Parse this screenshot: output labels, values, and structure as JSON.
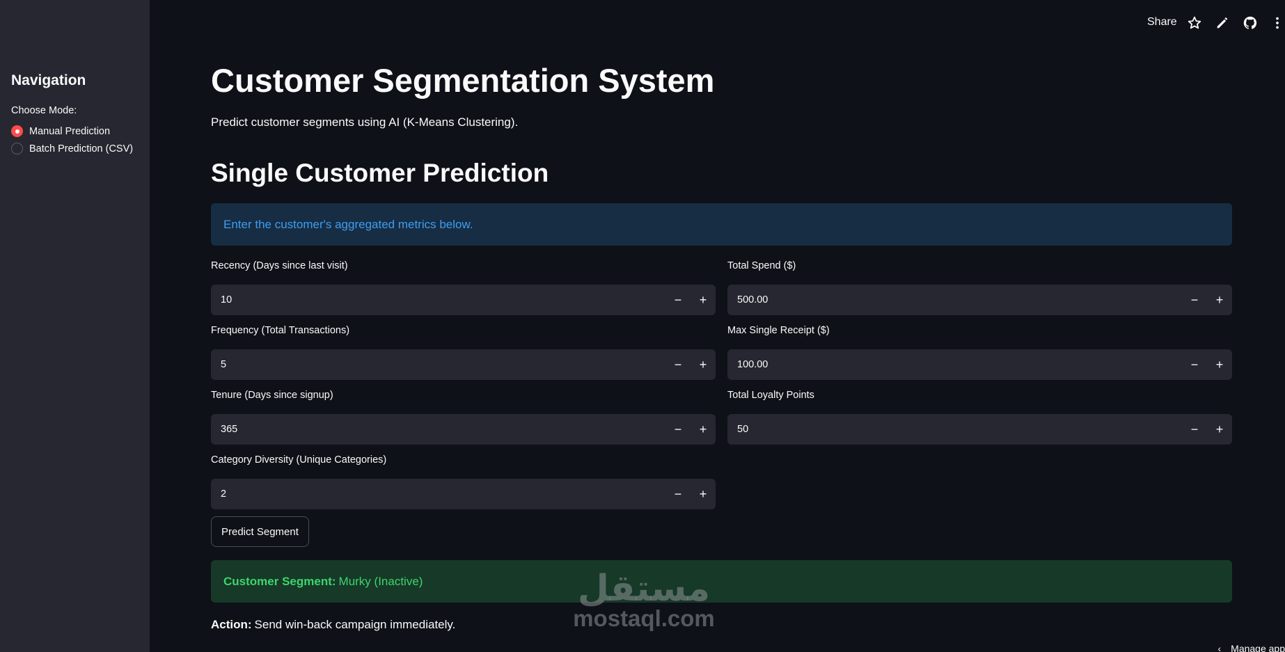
{
  "sidebar": {
    "title": "Navigation",
    "mode_label": "Choose Mode:",
    "options": [
      {
        "label": "Manual Prediction",
        "selected": true
      },
      {
        "label": "Batch Prediction (CSV)",
        "selected": false
      }
    ]
  },
  "toolbar": {
    "share_label": "Share",
    "icons": [
      "star-icon",
      "pencil-icon",
      "github-icon",
      "more-vertical-icon"
    ]
  },
  "main": {
    "title": "Customer Segmentation System",
    "subtitle": "Predict customer segments using AI (K-Means Clustering).",
    "section_title": "Single Customer Prediction",
    "info_text": "Enter the customer's aggregated metrics below.",
    "fields": {
      "recency": {
        "label": "Recency (Days since last visit)",
        "value": "10"
      },
      "total_spend": {
        "label": "Total Spend ($)",
        "value": "500.00"
      },
      "frequency": {
        "label": "Frequency (Total Transactions)",
        "value": "5"
      },
      "max_receipt": {
        "label": "Max Single Receipt ($)",
        "value": "100.00"
      },
      "tenure": {
        "label": "Tenure (Days since signup)",
        "value": "365"
      },
      "loyalty": {
        "label": "Total Loyalty Points",
        "value": "50"
      },
      "diversity": {
        "label": "Category Diversity (Unique Categories)",
        "value": "2"
      }
    },
    "stepper": {
      "minus": "−",
      "plus": "+"
    },
    "predict_label": "Predict Segment",
    "result": {
      "label": "Customer Segment:",
      "value": "Murky (Inactive)"
    },
    "action": {
      "label": "Action:",
      "value": "Send win-back campaign immediately."
    }
  },
  "watermark": {
    "arabic": "مستقل",
    "latin": "mostaql.com"
  },
  "manage_app_label": "Manage app",
  "colors": {
    "background": "#0e1117",
    "sidebar": "#262730",
    "accent": "#ff4b4b",
    "info_bg": "#172d43",
    "info_text": "#3d9df3",
    "success_bg": "#173928",
    "success_text": "#3dd56d"
  }
}
